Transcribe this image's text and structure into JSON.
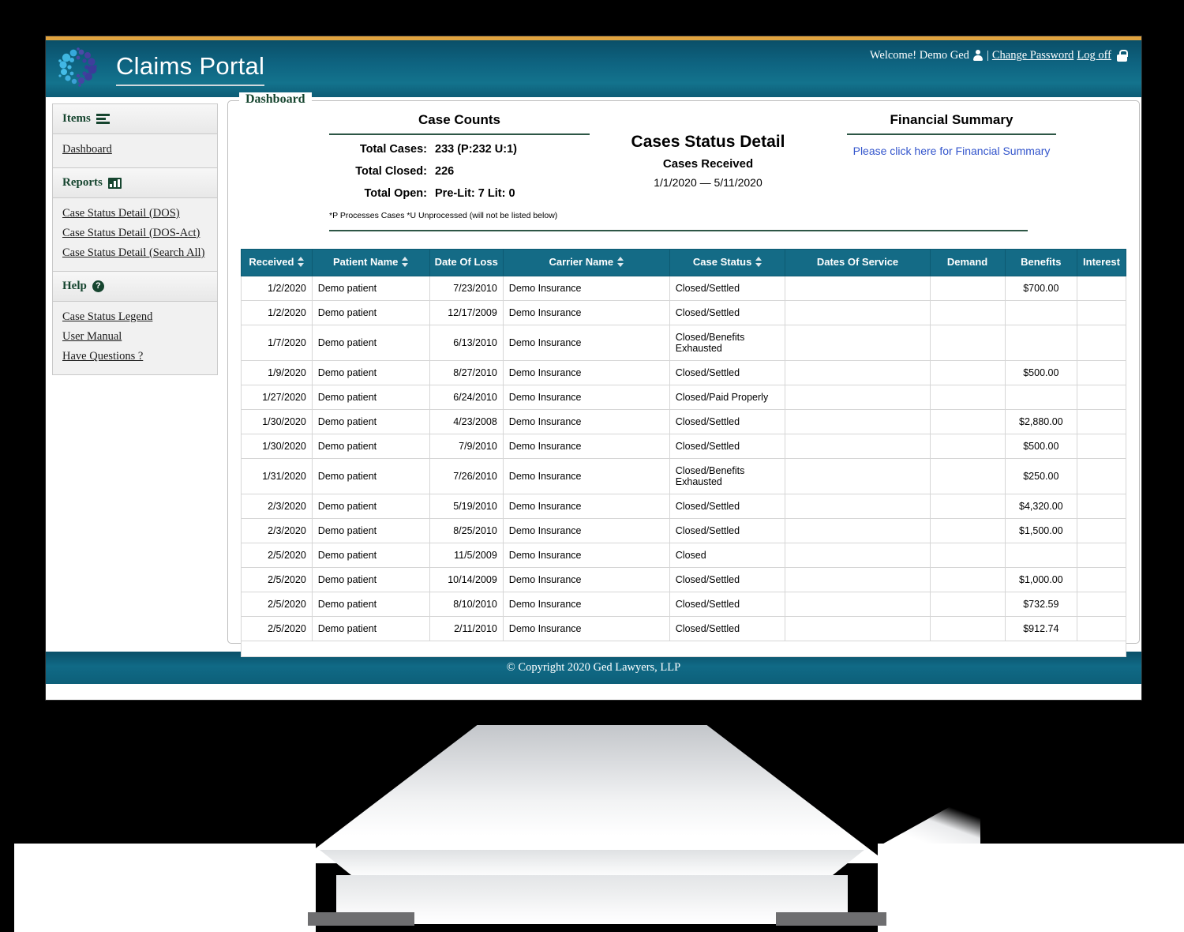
{
  "header": {
    "app_title": "Claims Portal",
    "logo_name": "claims-portal-logo",
    "welcome": "Welcome! Demo Ged",
    "separator": "|",
    "change_password": "Change Password",
    "log_off": "Log off"
  },
  "sidebar": {
    "items_header": "Items",
    "dashboard_link": "Dashboard",
    "reports_header": "Reports",
    "report_links": [
      "Case Status Detail (DOS)",
      "Case Status Detail (DOS-Act)",
      "Case Status Detail (Search All)"
    ],
    "help_header": "Help",
    "help_links": [
      "Case Status Legend",
      "User Manual",
      "Have Questions ?"
    ]
  },
  "main": {
    "legend": "Dashboard",
    "case_counts": {
      "title": "Case Counts",
      "rows": [
        {
          "label": "Total Cases:",
          "value": "233 (P:232 U:1)"
        },
        {
          "label": "Total Closed:",
          "value": "226"
        },
        {
          "label": "Total Open:",
          "value": "Pre-Lit: 7 Lit: 0"
        }
      ],
      "footnote": "*P Processes Cases   *U Unprocessed (will not be listed below)"
    },
    "center": {
      "title": "Cases Status Detail",
      "subtitle": "Cases Received",
      "date_range": "1/1/2020  —  5/11/2020"
    },
    "financial": {
      "title": "Financial Summary",
      "link": "Please click here for Financial Summary"
    },
    "table": {
      "columns": [
        {
          "label": "Received",
          "sortable": true
        },
        {
          "label": "Patient Name",
          "sortable": true
        },
        {
          "label": "Date Of Loss",
          "sortable": false
        },
        {
          "label": "Carrier Name",
          "sortable": true
        },
        {
          "label": "Case Status",
          "sortable": true
        },
        {
          "label": "Dates Of Service",
          "sortable": false
        },
        {
          "label": "Demand",
          "sortable": false
        },
        {
          "label": "Benefits",
          "sortable": false
        },
        {
          "label": "Interest",
          "sortable": false
        }
      ],
      "rows": [
        {
          "received": "1/2/2020",
          "patient": "Demo patient",
          "date_of_loss": "7/23/2010",
          "carrier": "Demo Insurance",
          "status": "Closed/Settled",
          "dates_of_service": "",
          "demand": "",
          "benefits": "$700.00",
          "interest": ""
        },
        {
          "received": "1/2/2020",
          "patient": "Demo patient",
          "date_of_loss": "12/17/2009",
          "carrier": "Demo Insurance",
          "status": "Closed/Settled",
          "dates_of_service": "",
          "demand": "",
          "benefits": "",
          "interest": ""
        },
        {
          "received": "1/7/2020",
          "patient": "Demo patient",
          "date_of_loss": "6/13/2010",
          "carrier": "Demo Insurance",
          "status": "Closed/Benefits Exhausted",
          "dates_of_service": "",
          "demand": "",
          "benefits": "",
          "interest": ""
        },
        {
          "received": "1/9/2020",
          "patient": "Demo patient",
          "date_of_loss": "8/27/2010",
          "carrier": "Demo Insurance",
          "status": "Closed/Settled",
          "dates_of_service": "",
          "demand": "",
          "benefits": "$500.00",
          "interest": ""
        },
        {
          "received": "1/27/2020",
          "patient": "Demo patient",
          "date_of_loss": "6/24/2010",
          "carrier": "Demo Insurance",
          "status": "Closed/Paid Properly",
          "dates_of_service": "",
          "demand": "",
          "benefits": "",
          "interest": ""
        },
        {
          "received": "1/30/2020",
          "patient": "Demo patient",
          "date_of_loss": "4/23/2008",
          "carrier": "Demo Insurance",
          "status": "Closed/Settled",
          "dates_of_service": "",
          "demand": "",
          "benefits": "$2,880.00",
          "interest": ""
        },
        {
          "received": "1/30/2020",
          "patient": "Demo patient",
          "date_of_loss": "7/9/2010",
          "carrier": "Demo Insurance",
          "status": "Closed/Settled",
          "dates_of_service": "",
          "demand": "",
          "benefits": "$500.00",
          "interest": ""
        },
        {
          "received": "1/31/2020",
          "patient": "Demo patient",
          "date_of_loss": "7/26/2010",
          "carrier": "Demo Insurance",
          "status": "Closed/Benefits Exhausted",
          "dates_of_service": "",
          "demand": "",
          "benefits": "$250.00",
          "interest": ""
        },
        {
          "received": "2/3/2020",
          "patient": "Demo patient",
          "date_of_loss": "5/19/2010",
          "carrier": "Demo Insurance",
          "status": "Closed/Settled",
          "dates_of_service": "",
          "demand": "",
          "benefits": "$4,320.00",
          "interest": ""
        },
        {
          "received": "2/3/2020",
          "patient": "Demo patient",
          "date_of_loss": "8/25/2010",
          "carrier": "Demo Insurance",
          "status": "Closed/Settled",
          "dates_of_service": "",
          "demand": "",
          "benefits": "$1,500.00",
          "interest": ""
        },
        {
          "received": "2/5/2020",
          "patient": "Demo patient",
          "date_of_loss": "11/5/2009",
          "carrier": "Demo Insurance",
          "status": "Closed",
          "dates_of_service": "",
          "demand": "",
          "benefits": "",
          "interest": ""
        },
        {
          "received": "2/5/2020",
          "patient": "Demo patient",
          "date_of_loss": "10/14/2009",
          "carrier": "Demo Insurance",
          "status": "Closed/Settled",
          "dates_of_service": "",
          "demand": "",
          "benefits": "$1,000.00",
          "interest": ""
        },
        {
          "received": "2/5/2020",
          "patient": "Demo patient",
          "date_of_loss": "8/10/2010",
          "carrier": "Demo Insurance",
          "status": "Closed/Settled",
          "dates_of_service": "",
          "demand": "",
          "benefits": "$732.59",
          "interest": ""
        },
        {
          "received": "2/5/2020",
          "patient": "Demo patient",
          "date_of_loss": "2/11/2010",
          "carrier": "Demo Insurance",
          "status": "Closed/Settled",
          "dates_of_service": "",
          "demand": "",
          "benefits": "$912.74",
          "interest": ""
        }
      ]
    }
  },
  "footer": {
    "copyright": "© Copyright 2020 Ged Lawyers, LLP"
  },
  "colors": {
    "header_teal": "#0e6380",
    "table_header_teal": "#146b86",
    "accent_orange": "#e0a33f",
    "link_blue": "#3355cc",
    "green_rule": "#2d5645"
  }
}
